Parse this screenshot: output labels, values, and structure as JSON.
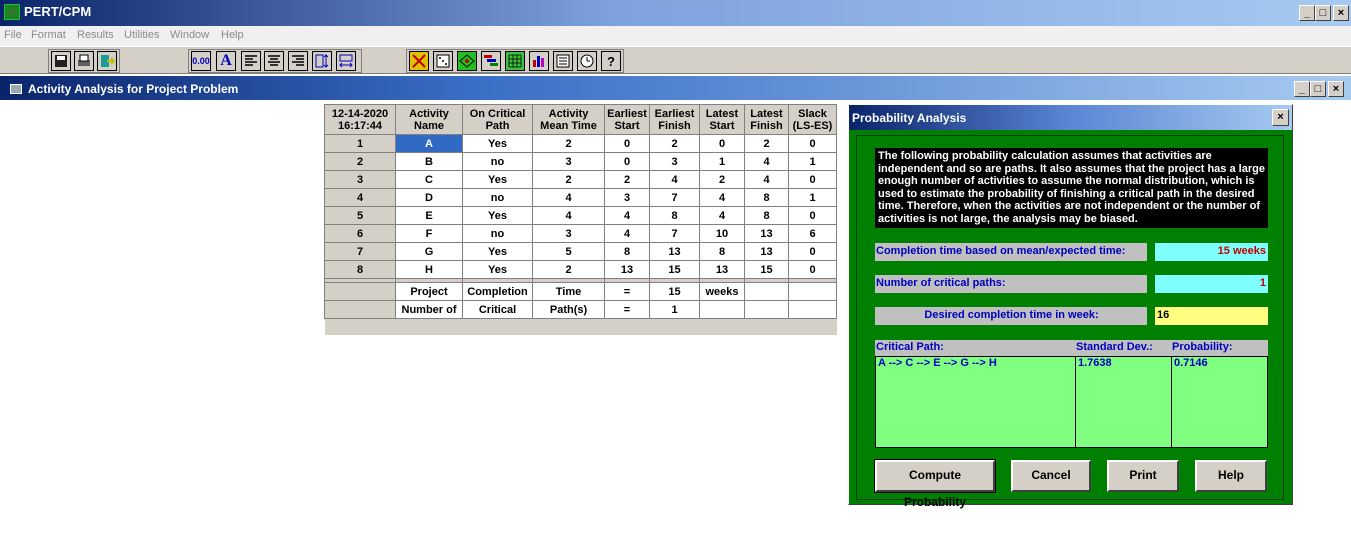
{
  "app": {
    "title": "PERT/CPM"
  },
  "menu": [
    "File",
    "Format",
    "Results",
    "Utilities",
    "Window",
    "Help"
  ],
  "toolbar": {
    "decimal_label": "0.00",
    "font_label": "A"
  },
  "mdi": {
    "title": "Activity Analysis for Project Problem"
  },
  "grid": {
    "corner": [
      "12-14-2020",
      "16:17:44"
    ],
    "headers": [
      [
        "Activity",
        "Name"
      ],
      [
        "On Critical",
        "Path"
      ],
      [
        "Activity",
        "Mean Time"
      ],
      [
        "Earliest",
        "Start"
      ],
      [
        "Earliest",
        "Finish"
      ],
      [
        "Latest",
        "Start"
      ],
      [
        "Latest",
        "Finish"
      ],
      [
        "Slack",
        "(LS-ES)"
      ]
    ],
    "rows": [
      [
        "1",
        "A",
        "Yes",
        "2",
        "0",
        "2",
        "0",
        "2",
        "0"
      ],
      [
        "2",
        "B",
        "no",
        "3",
        "0",
        "3",
        "1",
        "4",
        "1"
      ],
      [
        "3",
        "C",
        "Yes",
        "2",
        "2",
        "4",
        "2",
        "4",
        "0"
      ],
      [
        "4",
        "D",
        "no",
        "4",
        "3",
        "7",
        "4",
        "8",
        "1"
      ],
      [
        "5",
        "E",
        "Yes",
        "4",
        "4",
        "8",
        "4",
        "8",
        "0"
      ],
      [
        "6",
        "F",
        "no",
        "3",
        "4",
        "7",
        "10",
        "13",
        "6"
      ],
      [
        "7",
        "G",
        "Yes",
        "5",
        "8",
        "13",
        "8",
        "13",
        "0"
      ],
      [
        "8",
        "H",
        "Yes",
        "2",
        "13",
        "15",
        "13",
        "15",
        "0"
      ]
    ],
    "summary": [
      [
        "",
        "Project",
        "Completion",
        "Time",
        "=",
        "15",
        "weeks",
        "",
        ""
      ],
      [
        "",
        "Number of",
        "Critical",
        "Path(s)",
        "=",
        "1",
        "",
        "",
        ""
      ]
    ]
  },
  "dialog": {
    "title": "Probability Analysis",
    "close_label": "×",
    "description": "The following probability calculation assumes that activities are independent and so are paths. It also assumes that the project has a large enough number of activities to assume the normal distribution, which is used to estimate the probability of finishing a critical path in the desired time.  Therefore, when the activities are not independent or the number of activities is not large, the analysis may be biased.",
    "completion_label": "Completion time based on mean/expected time:",
    "completion_value": "15 weeks",
    "critical_paths_label": "Number of critical paths:",
    "critical_paths_value": "1",
    "desired_label": "Desired completion time in week:",
    "desired_value": "16",
    "col_path": "Critical Path:",
    "col_std": "Standard Dev.:",
    "col_prob": "Probability:",
    "path_value": "A --> C --> E --> G --> H",
    "std_value": "1.7638",
    "prob_value": "0.7146",
    "buttons": {
      "compute": "Compute Probability",
      "cancel": "Cancel",
      "print": "Print",
      "help": "Help"
    }
  },
  "colors": {
    "dialog_bg": "#008000",
    "cyan_field": "#80ffff",
    "yellow_field": "#ffff80",
    "green_list": "#80ff80"
  }
}
